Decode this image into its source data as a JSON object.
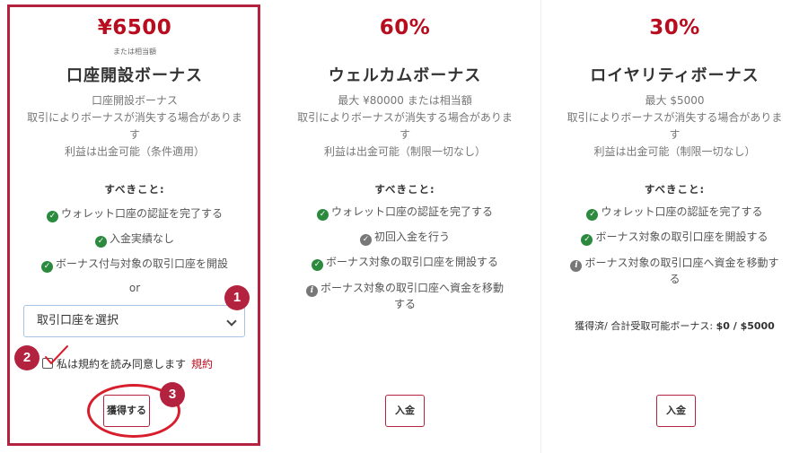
{
  "cards": [
    {
      "amount": "¥6500",
      "amount_sub": "または相当額",
      "title": "口座開設ボーナス",
      "desc": [
        "口座開設ボーナス",
        "取引によりボーナスが消失する場合がありま",
        "す",
        "利益は出金可能（条件適用）"
      ],
      "todo_heading": "すべきこと:",
      "requirements": [
        {
          "icon": "check-circle-icon",
          "text": "ウォレット口座の認証を完了する"
        },
        {
          "icon": "check-circle-icon",
          "text": "入金実績なし"
        },
        {
          "icon": "check-circle-icon",
          "text": "ボーナス付与対象の取引口座を開設"
        }
      ],
      "or_label": "or",
      "select_value": "取引口座を選択",
      "agree_text": "私は規約を読み同意します",
      "terms_link": "規約",
      "button_label": "獲得する"
    },
    {
      "amount": "60%",
      "title": "ウェルカムボーナス",
      "desc": [
        "最大 ¥80000 または相当額",
        "取引によりボーナスが消失する場合がありま",
        "す",
        "利益は出金可能（制限一切なし）"
      ],
      "todo_heading": "すべきこと:",
      "requirements": [
        {
          "icon": "check-circle-icon",
          "text": "ウォレット口座の認証を完了する"
        },
        {
          "icon": "check-circle-gray-icon",
          "text": "初回入金を行う"
        },
        {
          "icon": "check-circle-icon",
          "text": "ボーナス対象の取引口座を開設する"
        },
        {
          "icon": "info-circle-icon",
          "text": "ボーナス対象の取引口座へ資金を移動",
          "text2": "する"
        }
      ],
      "button_label": "入金"
    },
    {
      "amount": "30%",
      "title": "ロイヤリティボーナス",
      "desc": [
        "最大 $5000",
        "取引によりボーナスが消失する場合がありま",
        "す",
        "利益は出金可能（制限一切なし）"
      ],
      "todo_heading": "すべきこと:",
      "requirements": [
        {
          "icon": "check-circle-icon",
          "text": "ウォレット口座の認証を完了する"
        },
        {
          "icon": "check-circle-icon",
          "text": "ボーナス対象の取引口座を開設する"
        },
        {
          "icon": "info-circle-icon",
          "text": "ボーナス対象の取引口座へ資金を移動す",
          "text2": "る"
        }
      ],
      "earned_label": "獲得済/ 合計受取可能ボーナス:",
      "earned_value": "$0 / $5000",
      "button_label": "入金"
    }
  ],
  "annotations": {
    "badge1": "1",
    "badge2": "2",
    "badge3": "3"
  },
  "colors": {
    "accent": "#b80d1f",
    "frame": "#b3233f",
    "check": "#2b8a3e",
    "ellipse": "#d81e2c"
  }
}
